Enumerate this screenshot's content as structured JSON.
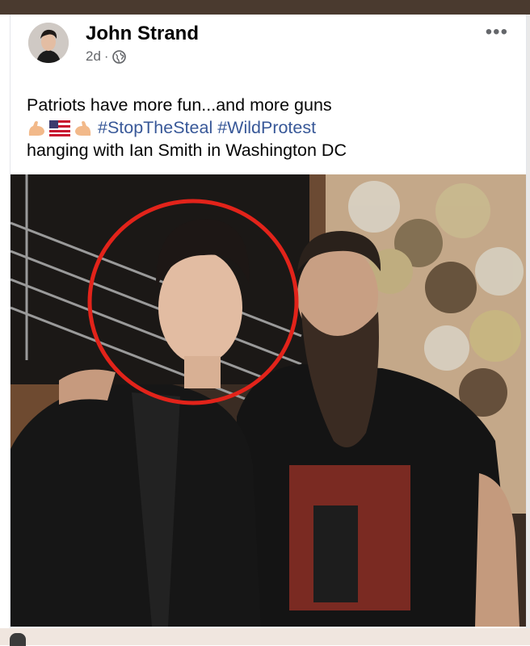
{
  "post": {
    "author_name": "John Strand",
    "timestamp": "2d",
    "separator": "·",
    "privacy_icon": "globe-icon",
    "more_icon": "more-dots-icon",
    "more_label": "•••",
    "text_line1": "Patriots have more fun...and more guns",
    "emojis": [
      "flexed-biceps-emoji",
      "us-flag-emoji",
      "flexed-biceps-emoji"
    ],
    "hashtag1": "#StopTheSteal",
    "hashtag2": "#WildProtest",
    "text_line3": "hanging with Ian Smith in Washington DC"
  },
  "colors": {
    "hashtag": "#385898",
    "name": "#050505",
    "meta": "#65676b",
    "annotation_circle": "#e2231a"
  }
}
